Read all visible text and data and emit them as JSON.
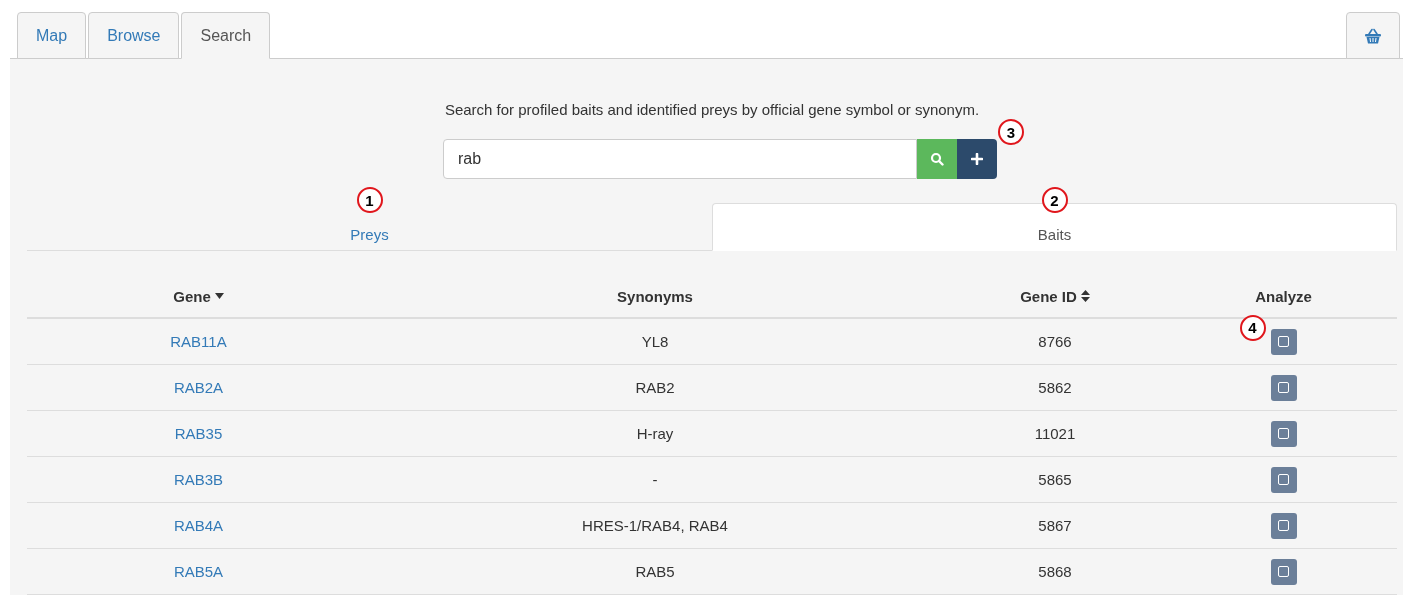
{
  "tabs": [
    {
      "label": "Map",
      "selected": false
    },
    {
      "label": "Browse",
      "selected": false
    },
    {
      "label": "Search",
      "selected": true
    }
  ],
  "description": "Search for profiled baits and identified preys by official gene symbol or synonym.",
  "search": {
    "value": "rab",
    "add_callout": "3"
  },
  "result_tabs": [
    {
      "label": "Preys",
      "selected": false,
      "callout": "1"
    },
    {
      "label": "Baits",
      "selected": true,
      "callout": "2"
    }
  ],
  "table": {
    "columns": [
      {
        "label": "Gene",
        "sortable": true,
        "sorted": true
      },
      {
        "label": "Synonyms",
        "sortable": false,
        "sorted": false
      },
      {
        "label": "Gene ID",
        "sortable": true,
        "sorted": false
      },
      {
        "label": "Analyze",
        "sortable": false,
        "sorted": false
      }
    ],
    "rows": [
      {
        "gene": "RAB11A",
        "synonyms": "YL8",
        "gene_id": "8766",
        "checked": false,
        "callout": "4"
      },
      {
        "gene": "RAB2A",
        "synonyms": "RAB2",
        "gene_id": "5862",
        "checked": false
      },
      {
        "gene": "RAB35",
        "synonyms": "H-ray",
        "gene_id": "11021",
        "checked": false
      },
      {
        "gene": "RAB3B",
        "synonyms": "-",
        "gene_id": "5865",
        "checked": false
      },
      {
        "gene": "RAB4A",
        "synonyms": "HRES-1/RAB4, RAB4",
        "gene_id": "5867",
        "checked": false
      },
      {
        "gene": "RAB5A",
        "synonyms": "RAB5",
        "gene_id": "5868",
        "checked": false
      }
    ]
  }
}
